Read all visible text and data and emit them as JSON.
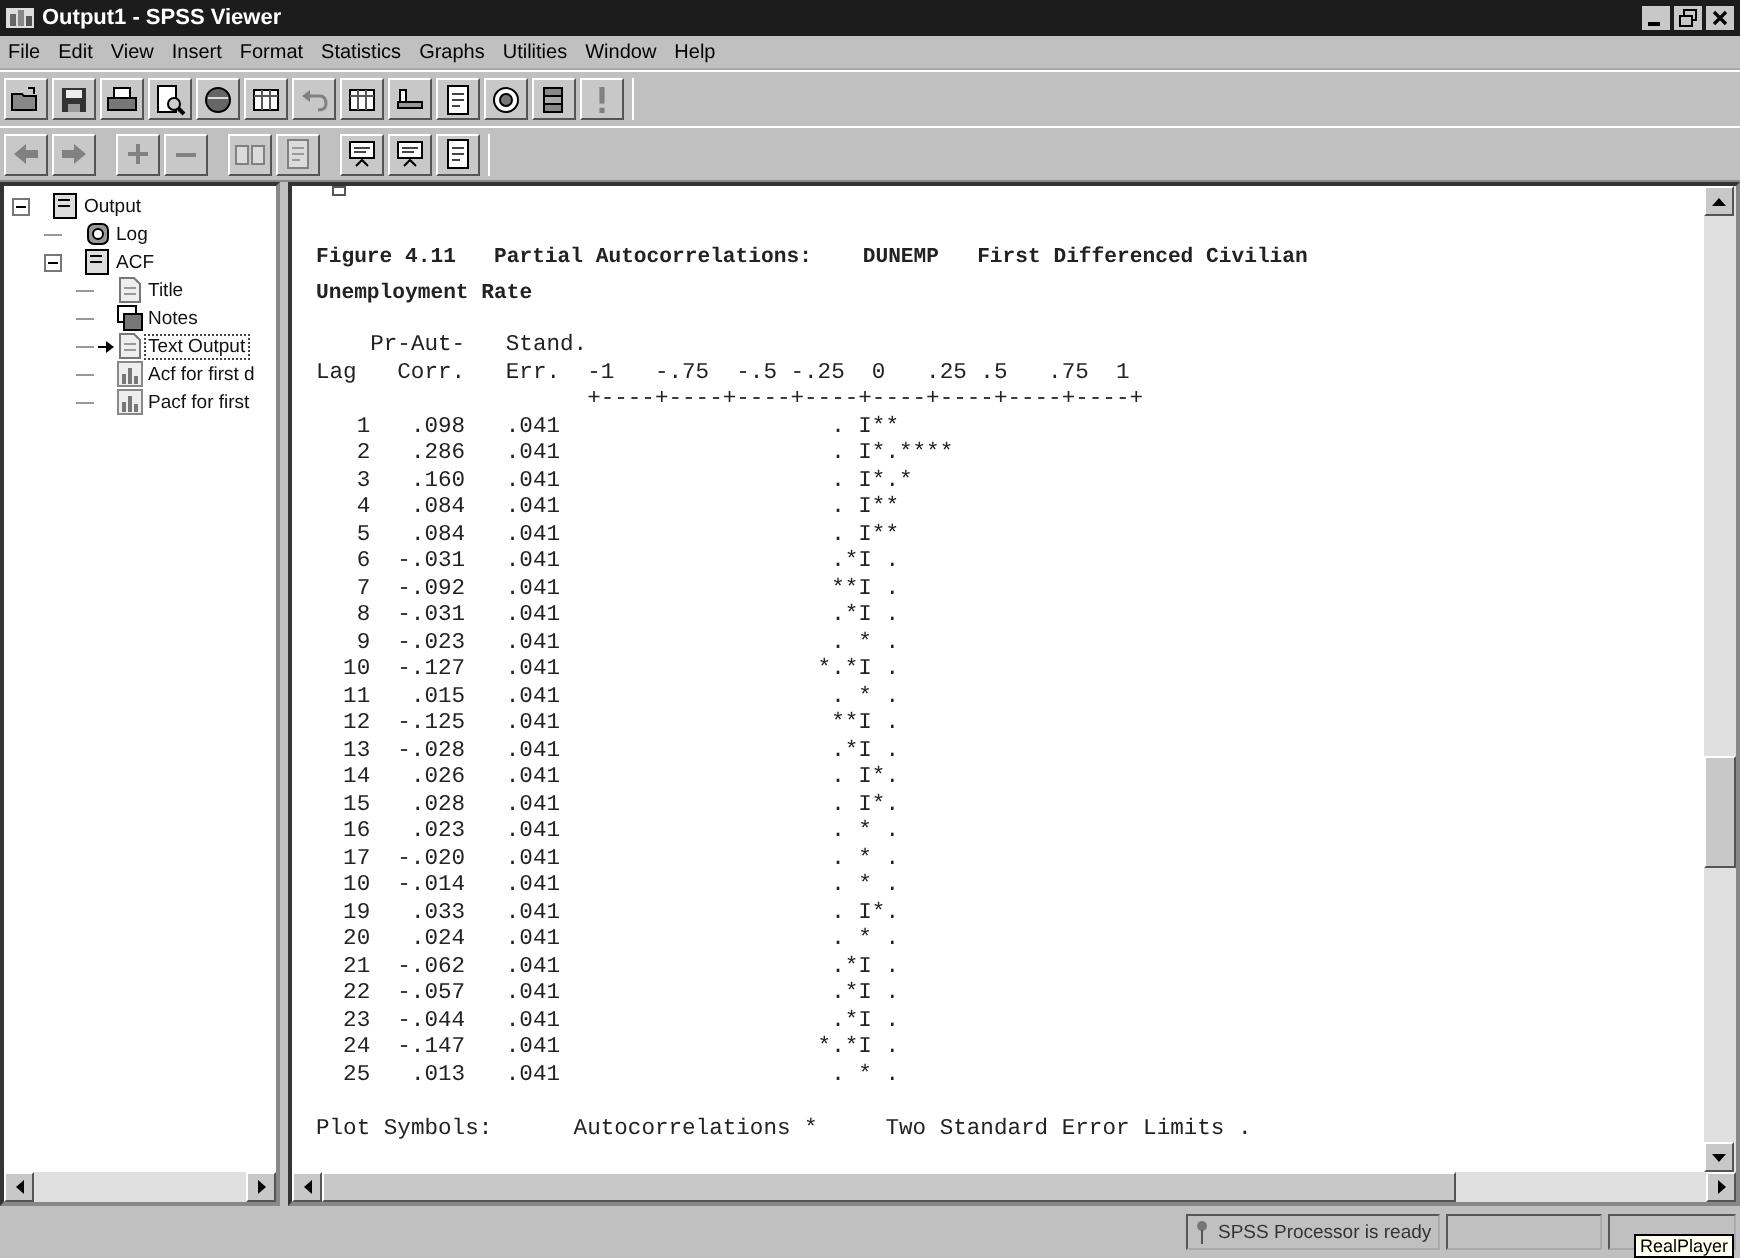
{
  "window": {
    "title": "Output1 - SPSS Viewer"
  },
  "menu": [
    "File",
    "Edit",
    "View",
    "Insert",
    "Format",
    "Statistics",
    "Graphs",
    "Utilities",
    "Window",
    "Help"
  ],
  "toolbar_1": [
    {
      "kind": "open",
      "disabled": false
    },
    {
      "kind": "save",
      "disabled": false
    },
    {
      "kind": "print",
      "disabled": false
    },
    {
      "kind": "preview",
      "disabled": false
    },
    {
      "kind": "export",
      "disabled": false
    },
    {
      "kind": "goto",
      "disabled": false
    },
    {
      "kind": "undo",
      "disabled": true
    },
    {
      "kind": "grid",
      "disabled": false
    },
    {
      "kind": "ruler",
      "disabled": false
    },
    {
      "kind": "page",
      "disabled": false
    },
    {
      "kind": "target",
      "disabled": false
    },
    {
      "kind": "stack",
      "disabled": false
    },
    {
      "kind": "run",
      "disabled": true
    }
  ],
  "toolbar_2": [
    {
      "kind": "back",
      "disabled": true
    },
    {
      "kind": "forward",
      "disabled": true
    },
    {
      "kind": "plus",
      "disabled": true
    },
    {
      "kind": "minus",
      "disabled": true
    },
    {
      "kind": "book",
      "disabled": true
    },
    {
      "kind": "page",
      "disabled": true
    },
    {
      "kind": "heading",
      "disabled": false
    },
    {
      "kind": "title",
      "disabled": false
    },
    {
      "kind": "text",
      "disabled": false
    }
  ],
  "outline": [
    {
      "label": "Output",
      "kind": "book",
      "expanded": true,
      "selected": false,
      "children": [
        {
          "label": "Log",
          "kind": "log",
          "selected": false
        },
        {
          "label": "ACF",
          "kind": "book",
          "expanded": true,
          "selected": false,
          "children": [
            {
              "label": "Title",
              "kind": "page",
              "selected": false
            },
            {
              "label": "Notes",
              "kind": "notes",
              "selected": false
            },
            {
              "label": "Text Output",
              "kind": "page",
              "selected": true
            },
            {
              "label": "Acf for first d",
              "kind": "chart",
              "selected": false
            },
            {
              "label": "Pacf for first",
              "kind": "chart",
              "selected": false
            }
          ]
        }
      ]
    }
  ],
  "output": {
    "title_lines": [
      "Figure 4.11   Partial Autocorrelations:    DUNEMP   First Differenced Civilian",
      "Unemployment Rate"
    ],
    "header_1": {
      "corr": "Pr-Aut-",
      "err": "Stand."
    },
    "header_2": {
      "lag": "Lag",
      "corr": "Corr.",
      "err": "Err.",
      "axis": "-1   -.75  -.5 -.25  0   .25 .5   .75  1"
    },
    "axis_rule": "+----+----+----+----+----+----+----+----+",
    "rows": [
      {
        "lag": "1",
        "corr": ".098",
        "err": ".041",
        "plot": "                  . I**"
      },
      {
        "lag": "2",
        "corr": ".286",
        "err": ".041",
        "plot": "                  . I*.****"
      },
      {
        "lag": "3",
        "corr": ".160",
        "err": ".041",
        "plot": "                  . I*.*"
      },
      {
        "lag": "4",
        "corr": ".084",
        "err": ".041",
        "plot": "                  . I**"
      },
      {
        "lag": "5",
        "corr": ".084",
        "err": ".041",
        "plot": "                  . I**"
      },
      {
        "lag": "6",
        "corr": "-.031",
        "err": ".041",
        "plot": "                  .*I ."
      },
      {
        "lag": "7",
        "corr": "-.092",
        "err": ".041",
        "plot": "                  **I ."
      },
      {
        "lag": "8",
        "corr": "-.031",
        "err": ".041",
        "plot": "                  .*I ."
      },
      {
        "lag": "9",
        "corr": "-.023",
        "err": ".041",
        "plot": "                  . * ."
      },
      {
        "lag": "10",
        "corr": "-.127",
        "err": ".041",
        "plot": "                 *.*I ."
      },
      {
        "lag": "11",
        "corr": ".015",
        "err": ".041",
        "plot": "                  . * ."
      },
      {
        "lag": "12",
        "corr": "-.125",
        "err": ".041",
        "plot": "                  **I ."
      },
      {
        "lag": "13",
        "corr": "-.028",
        "err": ".041",
        "plot": "                  .*I ."
      },
      {
        "lag": "14",
        "corr": ".026",
        "err": ".041",
        "plot": "                  . I*."
      },
      {
        "lag": "15",
        "corr": ".028",
        "err": ".041",
        "plot": "                  . I*."
      },
      {
        "lag": "16",
        "corr": ".023",
        "err": ".041",
        "plot": "                  . * ."
      },
      {
        "lag": "17",
        "corr": "-.020",
        "err": ".041",
        "plot": "                  . * ."
      },
      {
        "lag": "10",
        "corr": "-.014",
        "err": ".041",
        "plot": "                  . * ."
      },
      {
        "lag": "19",
        "corr": ".033",
        "err": ".041",
        "plot": "                  . I*."
      },
      {
        "lag": "20",
        "corr": ".024",
        "err": ".041",
        "plot": "                  . * ."
      },
      {
        "lag": "21",
        "corr": "-.062",
        "err": ".041",
        "plot": "                  .*I ."
      },
      {
        "lag": "22",
        "corr": "-.057",
        "err": ".041",
        "plot": "                  .*I ."
      },
      {
        "lag": "23",
        "corr": "-.044",
        "err": ".041",
        "plot": "                  .*I ."
      },
      {
        "lag": "24",
        "corr": "-.147",
        "err": ".041",
        "plot": "                 *.*I ."
      },
      {
        "lag": "25",
        "corr": ".013",
        "err": ".041",
        "plot": "                  . * ."
      }
    ],
    "legend": "Plot Symbols:      Autocorrelations *     Two Standard Error Limits ."
  },
  "status_bar": {
    "message": "SPSS Processor is ready",
    "tooltip": "RealPlayer"
  }
}
